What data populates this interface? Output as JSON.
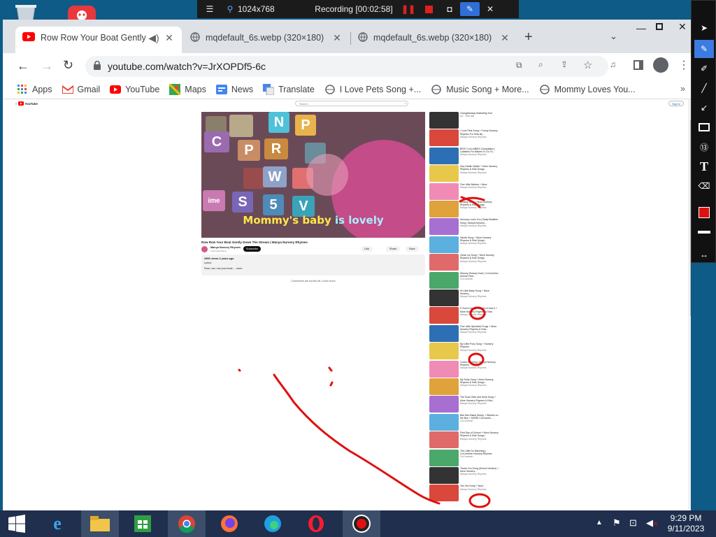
{
  "recorder": {
    "resolution": "1024x768",
    "status": "Recording [00:02:58]"
  },
  "browser": {
    "tabs": [
      {
        "label": "Row Row Your Boat Gently D",
        "active": true,
        "favicon": "youtube-icon"
      },
      {
        "label": "mqdefault_6s.webp (320×180)",
        "active": false,
        "favicon": "globe-icon"
      },
      {
        "label": "mqdefault_6s.webp (320×180)",
        "active": false,
        "favicon": "globe-icon"
      }
    ],
    "url": "youtube.com/watch?v=JrXOPDf5-6c",
    "bookmarks": [
      {
        "label": "Apps",
        "icon": "apps-grid-icon"
      },
      {
        "label": "Gmail",
        "icon": "gmail-icon"
      },
      {
        "label": "YouTube",
        "icon": "youtube-icon"
      },
      {
        "label": "Maps",
        "icon": "maps-icon"
      },
      {
        "label": "News",
        "icon": "news-icon"
      },
      {
        "label": "Translate",
        "icon": "translate-icon"
      },
      {
        "label": "I Love Pets Song +...",
        "icon": "globe-icon"
      },
      {
        "label": "Music Song + More...",
        "icon": "globe-icon"
      },
      {
        "label": "Mommy Loves You...",
        "icon": "globe-icon"
      }
    ]
  },
  "youtube": {
    "logo_text": "YouTube",
    "search_placeholder": "Search",
    "signin": "Sign in",
    "caption_part1": "Mommy's baby ",
    "caption_part2": "is lovely",
    "video_title": "Row Row Your Boat Gently Down The Stream | Manya Nursery Rhymes",
    "channel": "Manya Nursery Rhymes",
    "subs": "1.2M subscribers",
    "subscribe": "Subscribe",
    "like": "Like",
    "share": "Share",
    "save": "Save",
    "views": "296K views 3 years ago",
    "desc1": "Lyrics:",
    "desc2": "Row, row, row your boat ... more",
    "comments_off": "Comments are turned off. Learn more",
    "suggestions": [
      {
        "title": "Orangebeauty Marketing Tool",
        "sub": "Ad · Visit site"
      },
      {
        "title": "I Love Pets Song + Funny Nursery Rhymes For Kids By...",
        "sub": "Manya Nursery Rhymes"
      },
      {
        "title": "BEST LULLABIES Compilation | Lullabies For Babies To Go To...",
        "sub": "Manya Nursery Rhymes"
      },
      {
        "title": "Hey Diddle Diddle + More Nursery Rhymes & Kids Songs",
        "sub": "Manya Nursery Rhymes"
      },
      {
        "title": "Five Little Babies + More",
        "sub": "Manya Nursery Rhymes"
      },
      {
        "title": "Hurting Song + More Nursery Rhymes & Kids Songs",
        "sub": "Manya Nursery Rhymes"
      },
      {
        "title": "Mommy Loves You | Baby Bedtime Song | Manya Nursery...",
        "sub": "Manya Nursery Rhymes"
      },
      {
        "title": "Hands Song + More Nursery Rhymes & Kids Songs -",
        "sub": "Manya Nursery Rhymes"
      },
      {
        "title": "Clean Up Song + More Nursery Rhymes & Kids Songs",
        "sub": "Manya Nursery Rhymes"
      },
      {
        "title": "Hickory Dickory Dock | CoComelon Animal Time...",
        "sub": "CoComelon"
      },
      {
        "title": "Hi Little Baby Song + More Nursery...",
        "sub": "Manya Nursery Rhymes"
      },
      {
        "title": "If You're Happy And You Know It + More Nursery Rhymes & Kids",
        "sub": "Manya Nursery Rhymes"
      },
      {
        "title": "Five Little Speckled Frogs + More Nursery Rhymes & Kids...",
        "sub": "Manya Nursery Rhymes"
      },
      {
        "title": "My Little Pony Song + Nursery Rhymes",
        "sub": "Manya Nursery Rhymes"
      },
      {
        "title": "Cocks Do Song | Manya Nursery Rhymes",
        "sub": "Manya Nursery Rhymes"
      },
      {
        "title": "My Dolly Song + More Nursery Rhymes & Kids Songs -",
        "sub": "Manya Nursery Rhymes"
      },
      {
        "title": "The Duck Hide and Seek Song + More Nursery Rhymes & Kids...",
        "sub": "Manya Nursery Rhymes"
      },
      {
        "title": "Bee Bee Black Sheep + Wheels on the Bus + MORE CoComelo...",
        "sub": "CoComelon"
      },
      {
        "title": "First Day of School + More Nursery Rhymes & Kids Songs -",
        "sub": "Manya Nursery Rhymes"
      },
      {
        "title": "The Little Do Marching | CoComelon Nursery Rhymes",
        "sub": "CoComelon"
      },
      {
        "title": "Thank You Song (School Version) + More Nursery...",
        "sub": "Manya Nursery Rhymes"
      },
      {
        "title": "Yes Yes Song + More",
        "sub": "Manya Nursery Rhymes"
      }
    ]
  },
  "taskbar": {
    "time": "9:29 PM",
    "date": "9/11/2023"
  },
  "colors": {
    "youtube_red": "#ff0000",
    "ink_red": "#e01010",
    "taskbar": "#1f2f4d",
    "desktop": "#0d5b86"
  }
}
